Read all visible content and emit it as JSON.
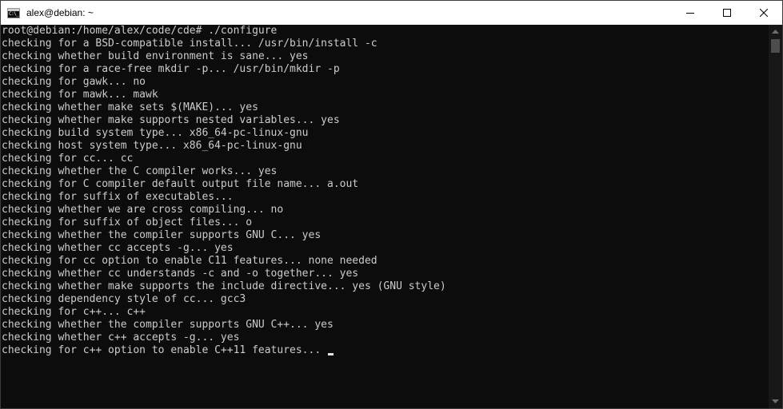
{
  "window": {
    "title": "alex@debian: ~",
    "app_icon_text": "C:\\_"
  },
  "controls": {
    "minimize": "minimize-icon",
    "maximize": "maximize-icon",
    "close": "close-icon"
  },
  "terminal": {
    "background": "#0c0c0c",
    "foreground": "#cccccc",
    "lines": [
      "root@debian:/home/alex/code/cde# ./configure",
      "checking for a BSD-compatible install... /usr/bin/install -c",
      "checking whether build environment is sane... yes",
      "checking for a race-free mkdir -p... /usr/bin/mkdir -p",
      "checking for gawk... no",
      "checking for mawk... mawk",
      "checking whether make sets $(MAKE)... yes",
      "checking whether make supports nested variables... yes",
      "checking build system type... x86_64-pc-linux-gnu",
      "checking host system type... x86_64-pc-linux-gnu",
      "checking for cc... cc",
      "checking whether the C compiler works... yes",
      "checking for C compiler default output file name... a.out",
      "checking for suffix of executables...",
      "checking whether we are cross compiling... no",
      "checking for suffix of object files... o",
      "checking whether the compiler supports GNU C... yes",
      "checking whether cc accepts -g... yes",
      "checking for cc option to enable C11 features... none needed",
      "checking whether cc understands -c and -o together... yes",
      "checking whether make supports the include directive... yes (GNU style)",
      "checking dependency style of cc... gcc3",
      "checking for c++... c++",
      "checking whether the compiler supports GNU C++... yes",
      "checking whether c++ accepts -g... yes"
    ],
    "current_line": "checking for c++ option to enable C++11 features... "
  }
}
